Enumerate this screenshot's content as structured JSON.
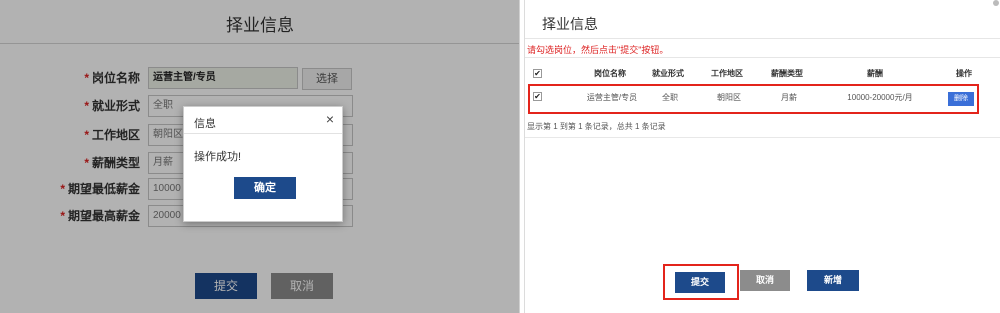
{
  "left": {
    "title": "择业信息",
    "fields": [
      {
        "label": "岗位名称",
        "value": "运营主管/专员"
      },
      {
        "label": "就业形式",
        "value": "全职"
      },
      {
        "label": "工作地区",
        "value": "朝阳区"
      },
      {
        "label": "薪酬类型",
        "value": "月薪"
      },
      {
        "label": "期望最低薪金",
        "value": "10000"
      },
      {
        "label": "期望最高薪金",
        "value": "20000"
      }
    ],
    "required_mark": "*",
    "select_label": "选择",
    "submit_label": "提交",
    "cancel_label": "取消",
    "dialog": {
      "title": "信息",
      "close": "×",
      "message": "操作成功!",
      "ok_label": "确定"
    }
  },
  "right": {
    "title": "择业信息",
    "hint": "请勾选岗位，然后点击\"提交\"按钮。",
    "columns": [
      "岗位名称",
      "就业形式",
      "工作地区",
      "薪酬类型",
      "薪酬",
      "操作"
    ],
    "row": {
      "checked": "✔",
      "job": "运营主管/专员",
      "type": "全职",
      "area": "朝阳区",
      "pay_type": "月薪",
      "salary": "10000-20000元/月",
      "action": "删除"
    },
    "header_check": "✔",
    "summary": "显示第 1 到第 1 条记录，总共 1 条记录",
    "submit_label": "提交",
    "cancel_label": "取消",
    "add_label": "新增"
  }
}
